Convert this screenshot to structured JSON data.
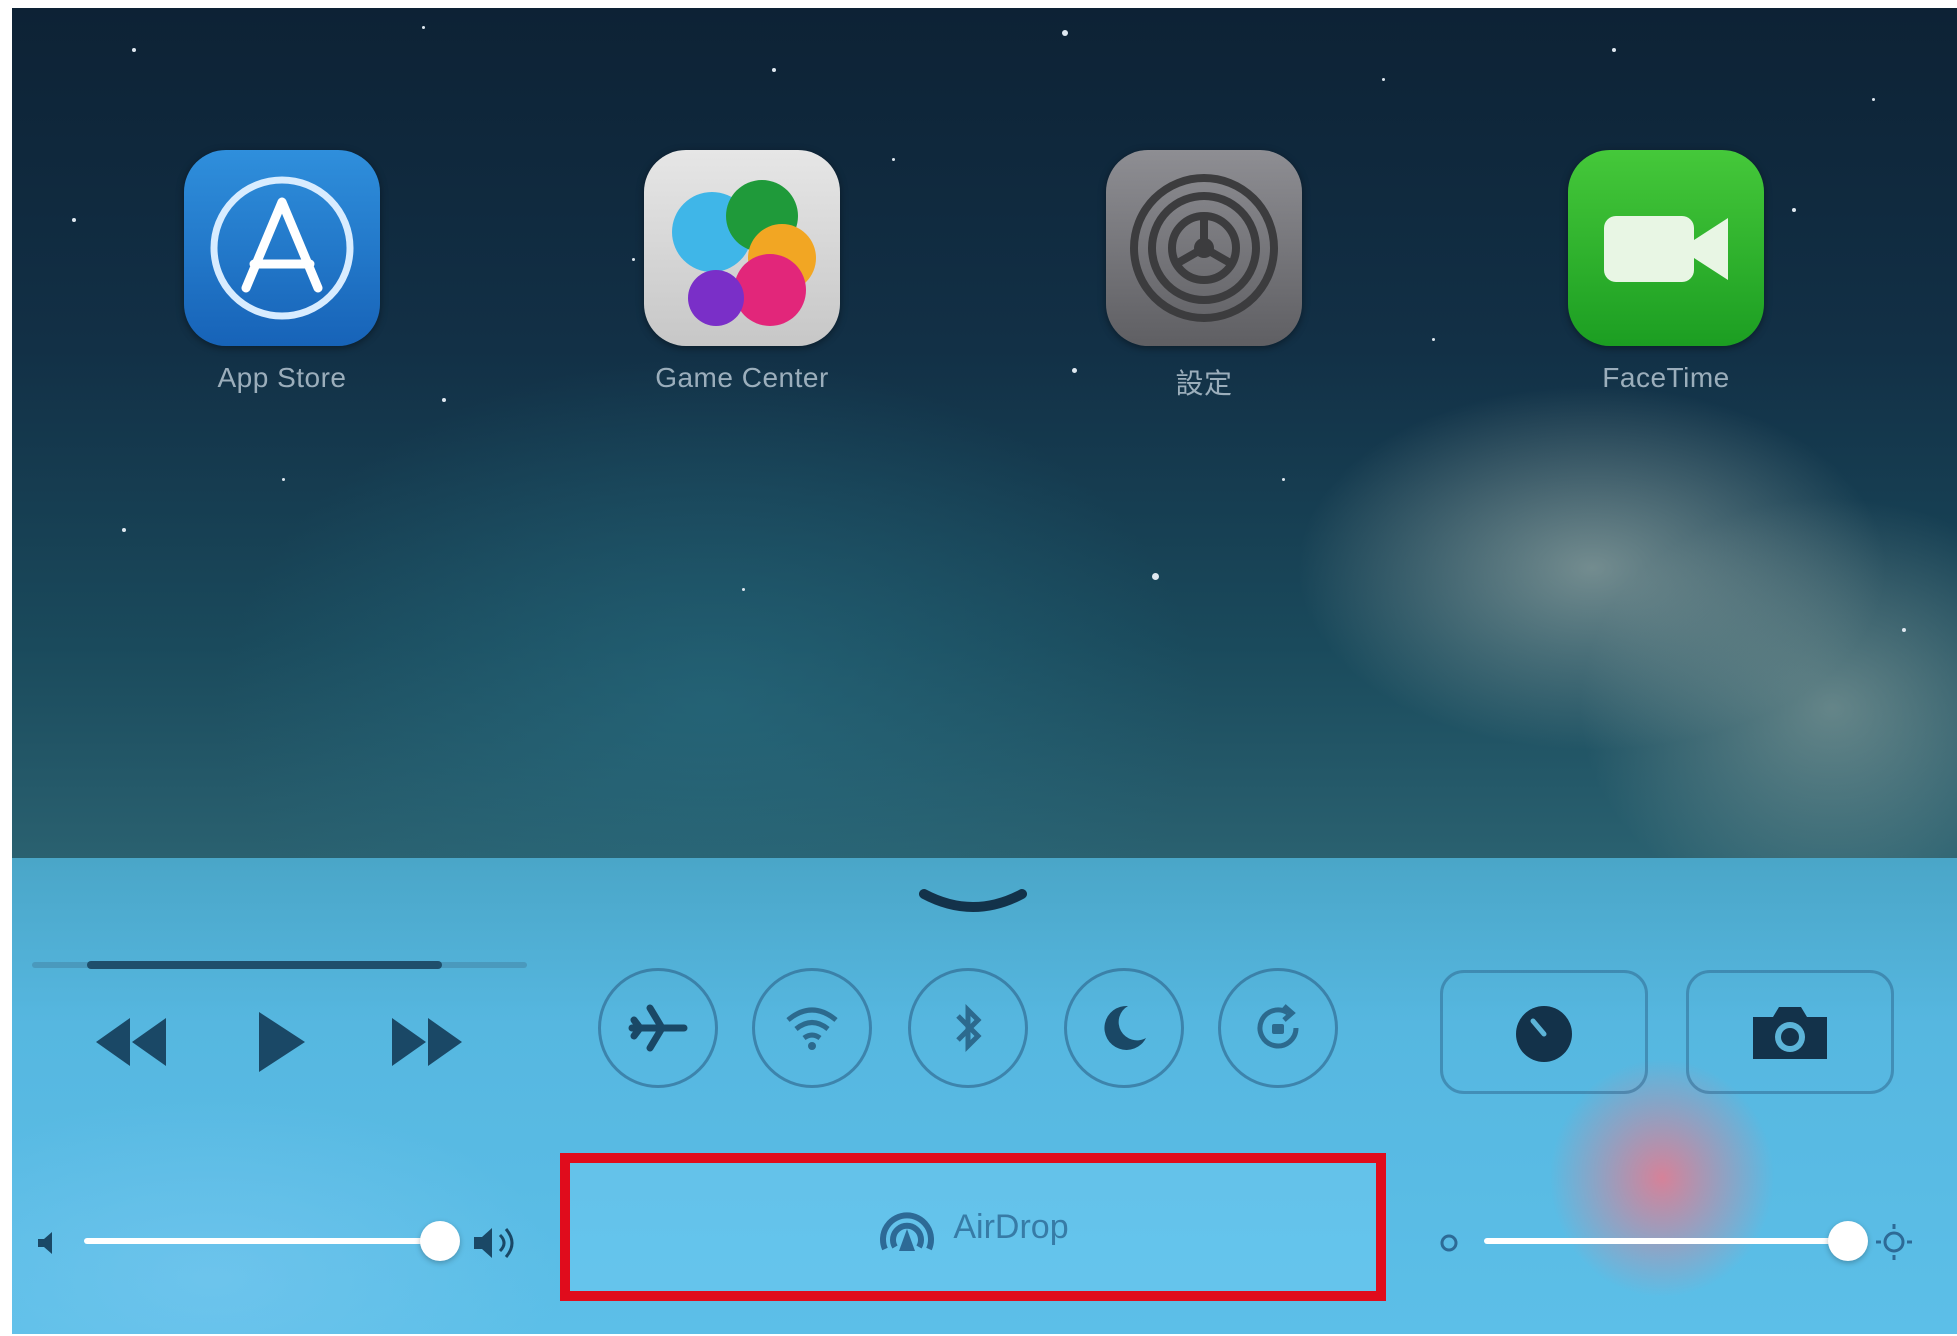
{
  "home_screen": {
    "apps": [
      {
        "label": "App Store",
        "icon": "app-store-icon"
      },
      {
        "label": "Game Center",
        "icon": "game-center-icon"
      },
      {
        "label": "設定",
        "icon": "settings-icon"
      },
      {
        "label": "FaceTime",
        "icon": "facetime-icon"
      }
    ]
  },
  "control_center": {
    "media": {
      "progress": 0.74,
      "controls": [
        "rewind-icon",
        "play-icon",
        "fast-forward-icon"
      ]
    },
    "toggles": [
      "airplane-mode-icon",
      "wifi-icon",
      "bluetooth-icon",
      "do-not-disturb-icon",
      "rotation-lock-icon"
    ],
    "shortcuts": [
      "timer-icon",
      "camera-icon"
    ],
    "volume": {
      "level": 0.9
    },
    "airdrop": {
      "label": "AirDrop",
      "icon": "airdrop-icon"
    },
    "brightness": {
      "level": 0.94
    },
    "highlight_color": "#e00c1c"
  }
}
